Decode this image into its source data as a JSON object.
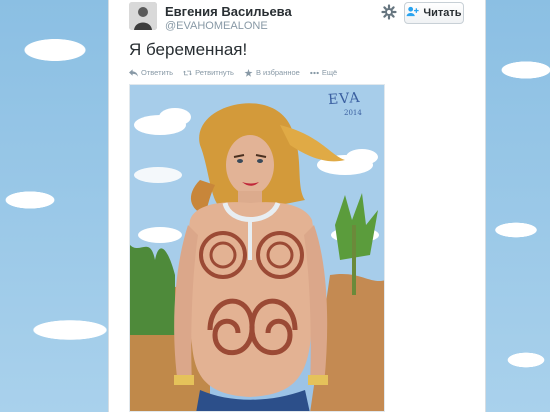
{
  "tweet": {
    "author": {
      "full_name": "Евгения Васильева",
      "username": "@EVAHOMEALONE",
      "avatar_icon": "user-avatar"
    },
    "follow_button": {
      "label": "Читать",
      "icon": "follow-person-plus-icon"
    },
    "settings_icon": "gear-icon",
    "text": "Я беременная!",
    "actions": [
      {
        "label": "Ответить",
        "icon": "reply-icon"
      },
      {
        "label": "Ретвитнуть",
        "icon": "retweet-icon"
      },
      {
        "label": "В избранное",
        "icon": "star-icon"
      },
      {
        "label": "Ещё",
        "icon": "more-icon"
      }
    ],
    "media": {
      "signature": "EVA",
      "signature_year": "2014"
    }
  },
  "colors": {
    "page_background": "#c0deed",
    "card_background": "#ffffff",
    "text_primary": "#292f33",
    "text_secondary": "#8899a6",
    "accent": "#2aa3ef"
  }
}
